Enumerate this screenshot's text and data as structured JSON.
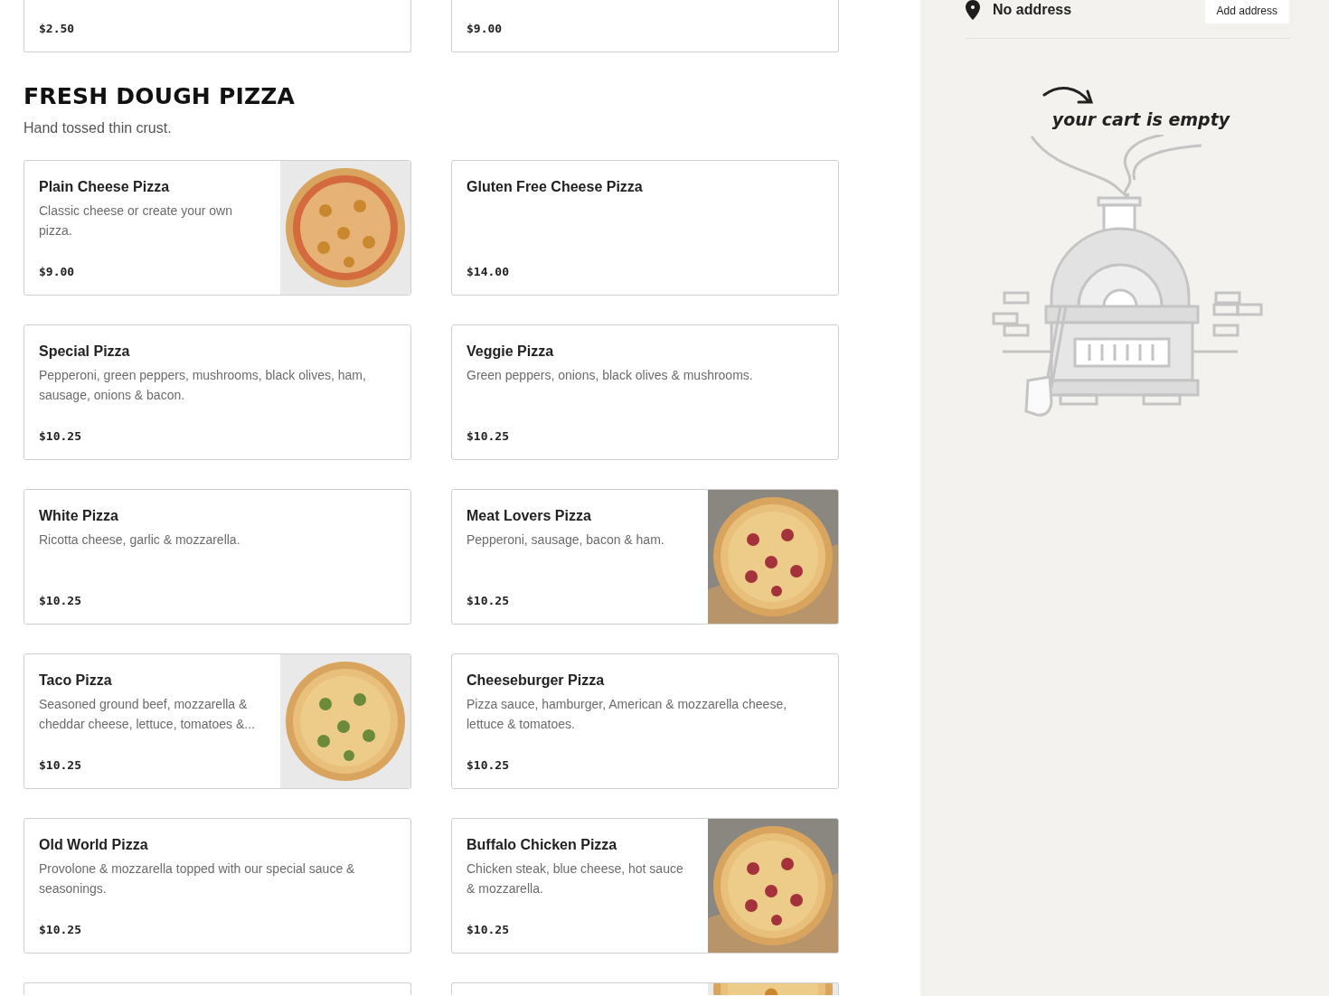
{
  "menu": {
    "top_items": [
      {
        "price": "$2.50"
      },
      {
        "price": "$9.00"
      }
    ],
    "section": {
      "title": "FRESH DOUGH PIZZA",
      "subtitle": "Hand tossed thin crust."
    },
    "items": [
      {
        "name": "Plain Cheese Pizza",
        "description": "Classic cheese or create your own pizza.",
        "price": "$9.00"
      },
      {
        "name": "Gluten Free Cheese Pizza",
        "price": "$14.00"
      },
      {
        "name": "Special Pizza",
        "description": "Pepperoni, green peppers, mushrooms, black olives, ham, sausage, onions & bacon.",
        "price": "$10.25"
      },
      {
        "name": "Veggie Pizza",
        "description": "Green peppers, onions, black olives & mushrooms.",
        "price": "$10.25"
      },
      {
        "name": "White Pizza",
        "description": "Ricotta cheese, garlic & mozzarella.",
        "price": "$10.25"
      },
      {
        "name": "Meat Lovers Pizza",
        "description": "Pepperoni, sausage, bacon & ham.",
        "price": "$10.25"
      },
      {
        "name": "Taco Pizza",
        "description": "Seasoned ground beef, mozzarella & cheddar cheese, lettuce, tomatoes &...",
        "price": "$10.25"
      },
      {
        "name": "Cheeseburger Pizza",
        "description": "Pizza sauce, hamburger, American & mozzarella cheese, lettuce & tomatoes.",
        "price": "$10.25"
      },
      {
        "name": "Old World Pizza",
        "description": "Provolone & mozzarella topped with our special sauce & seasonings.",
        "price": "$10.25"
      },
      {
        "name": "Buffalo Chicken Pizza",
        "description": "Chicken steak, blue cheese, hot sauce & mozzarella.",
        "price": "$10.25"
      }
    ],
    "bottom_items": [
      {
        "kind": "plain"
      },
      {
        "kind": "with_picture"
      }
    ]
  },
  "cart": {
    "address": "No address",
    "add_address_button": "Add address",
    "empty_message": "your cart is empty"
  }
}
